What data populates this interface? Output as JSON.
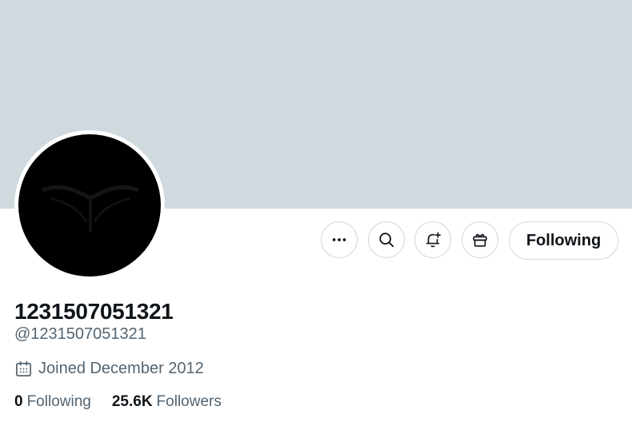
{
  "profile": {
    "display_name": "1231507051321",
    "handle": "@1231507051321",
    "joined": "Joined December 2012",
    "following_count": "0",
    "following_label": "Following",
    "followers_count": "25.6K",
    "followers_label": "Followers"
  },
  "actions": {
    "more_icon": "more-horizontal-icon",
    "search_icon": "search-icon",
    "notify_icon": "bell-plus-icon",
    "gift_icon": "gift-icon",
    "follow_label": "Following"
  },
  "colors": {
    "banner": "#cfd9de",
    "text_primary": "#0f1419",
    "text_secondary": "#536471",
    "border": "#cfd9de"
  }
}
